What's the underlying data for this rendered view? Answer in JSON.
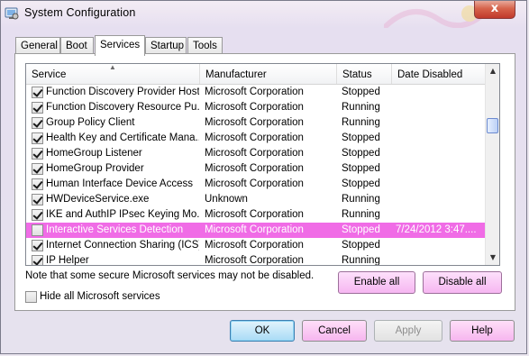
{
  "window": {
    "title": "System Configuration",
    "close_label": "x"
  },
  "tabs": [
    {
      "label": "General",
      "active": false
    },
    {
      "label": "Boot",
      "active": false
    },
    {
      "label": "Services",
      "active": true
    },
    {
      "label": "Startup",
      "active": false
    },
    {
      "label": "Tools",
      "active": false
    }
  ],
  "services_table": {
    "columns": [
      "Service",
      "Manufacturer",
      "Status",
      "Date Disabled"
    ],
    "sort_indicator": "▲",
    "rows": [
      {
        "checked": true,
        "name": "Function Discovery Provider Host",
        "manufacturer": "Microsoft Corporation",
        "status": "Stopped",
        "date_disabled": "",
        "selected": false
      },
      {
        "checked": true,
        "name": "Function Discovery Resource Pu...",
        "manufacturer": "Microsoft Corporation",
        "status": "Running",
        "date_disabled": "",
        "selected": false
      },
      {
        "checked": true,
        "name": "Group Policy Client",
        "manufacturer": "Microsoft Corporation",
        "status": "Running",
        "date_disabled": "",
        "selected": false
      },
      {
        "checked": true,
        "name": "Health Key and Certificate Mana...",
        "manufacturer": "Microsoft Corporation",
        "status": "Stopped",
        "date_disabled": "",
        "selected": false
      },
      {
        "checked": true,
        "name": "HomeGroup Listener",
        "manufacturer": "Microsoft Corporation",
        "status": "Stopped",
        "date_disabled": "",
        "selected": false
      },
      {
        "checked": true,
        "name": "HomeGroup Provider",
        "manufacturer": "Microsoft Corporation",
        "status": "Stopped",
        "date_disabled": "",
        "selected": false
      },
      {
        "checked": true,
        "name": "Human Interface Device Access",
        "manufacturer": "Microsoft Corporation",
        "status": "Stopped",
        "date_disabled": "",
        "selected": false
      },
      {
        "checked": true,
        "name": "HWDeviceService.exe",
        "manufacturer": "Unknown",
        "status": "Running",
        "date_disabled": "",
        "selected": false
      },
      {
        "checked": true,
        "name": "IKE and AuthIP IPsec Keying Mo...",
        "manufacturer": "Microsoft Corporation",
        "status": "Running",
        "date_disabled": "",
        "selected": false
      },
      {
        "checked": false,
        "name": "Interactive Services Detection",
        "manufacturer": "Microsoft Corporation",
        "status": "Stopped",
        "date_disabled": "7/24/2012 3:47....",
        "selected": true
      },
      {
        "checked": true,
        "name": "Internet Connection Sharing (ICS)",
        "manufacturer": "Microsoft Corporation",
        "status": "Stopped",
        "date_disabled": "",
        "selected": false
      },
      {
        "checked": true,
        "name": "IP Helper",
        "manufacturer": "Microsoft Corporation",
        "status": "Running",
        "date_disabled": "",
        "selected": false
      }
    ]
  },
  "note": "Note that some secure Microsoft services may not be disabled.",
  "enable_all_label": "Enable all",
  "disable_all_label": "Disable all",
  "hide_ms": {
    "label": "Hide all Microsoft services",
    "checked": false
  },
  "buttons": {
    "ok": "OK",
    "cancel": "Cancel",
    "apply": "Apply",
    "help": "Help"
  },
  "colors": {
    "selection": "#f06ce6",
    "pink_button": "#f6b6f1",
    "ok_button": "#a9dbf6"
  }
}
